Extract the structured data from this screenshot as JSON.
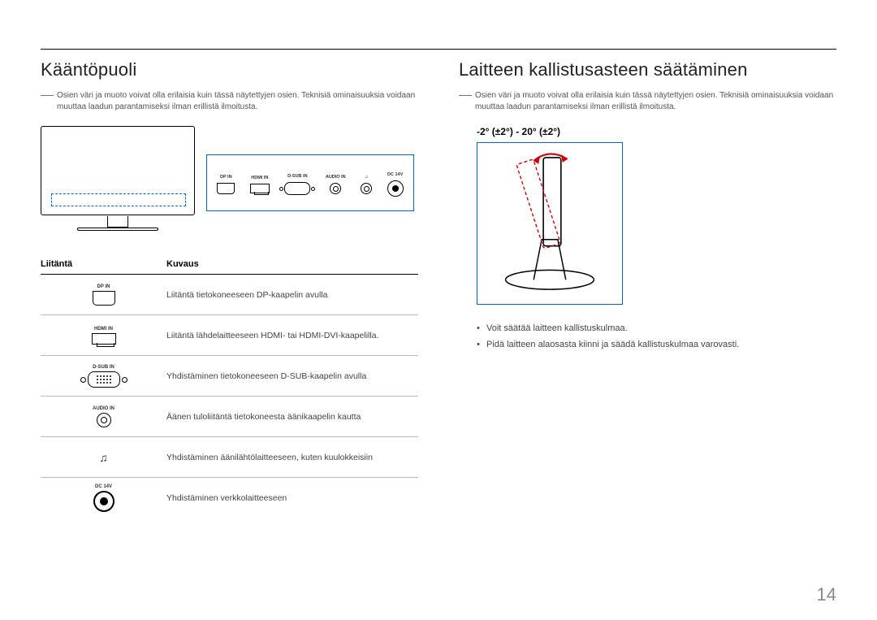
{
  "left": {
    "heading": "Kääntöpuoli",
    "footnote": "Osien väri ja muoto voivat olla erilaisia kuin tässä näytettyjen osien. Teknisiä ominaisuuksia voidaan muuttaa laadun parantamiseksi ilman erillistä ilmoitusta.",
    "ports_strip": [
      "DP IN",
      "HDMI IN",
      "D-SUB IN",
      "AUDIO IN",
      "♫",
      "DC 14V"
    ],
    "table": {
      "col1": "Liitäntä",
      "col2": "Kuvaus",
      "rows": [
        {
          "label": "DP IN",
          "desc": "Liitäntä tietokoneeseen DP-kaapelin avulla"
        },
        {
          "label": "HDMI IN",
          "desc": "Liitäntä lähdelaitteeseen HDMI- tai HDMI-DVI-kaapelilla."
        },
        {
          "label": "D-SUB IN",
          "desc": "Yhdistäminen tietokoneeseen D-SUB-kaapelin avulla"
        },
        {
          "label": "AUDIO IN",
          "desc": "Äänen tuloliitäntä tietokoneesta äänikaapelin kautta"
        },
        {
          "label": "♫",
          "desc": "Yhdistäminen äänilähtölaitteeseen, kuten kuulokkeisiin"
        },
        {
          "label": "DC 14V",
          "desc": "Yhdistäminen verkkolaitteeseen"
        }
      ]
    }
  },
  "right": {
    "heading": "Laitteen kallistusasteen säätäminen",
    "footnote": "Osien väri ja muoto voivat olla erilaisia kuin tässä näytettyjen osien. Teknisiä ominaisuuksia voidaan muuttaa laadun parantamiseksi ilman erillistä ilmoitusta.",
    "tilt_range": "-2° (±2°) - 20° (±2°)",
    "bullets": [
      "Voit säätää laitteen kallistuskulmaa.",
      "Pidä laitteen alaosasta kiinni ja säädä kallistuskulmaa varovasti."
    ]
  },
  "page_number": "14"
}
